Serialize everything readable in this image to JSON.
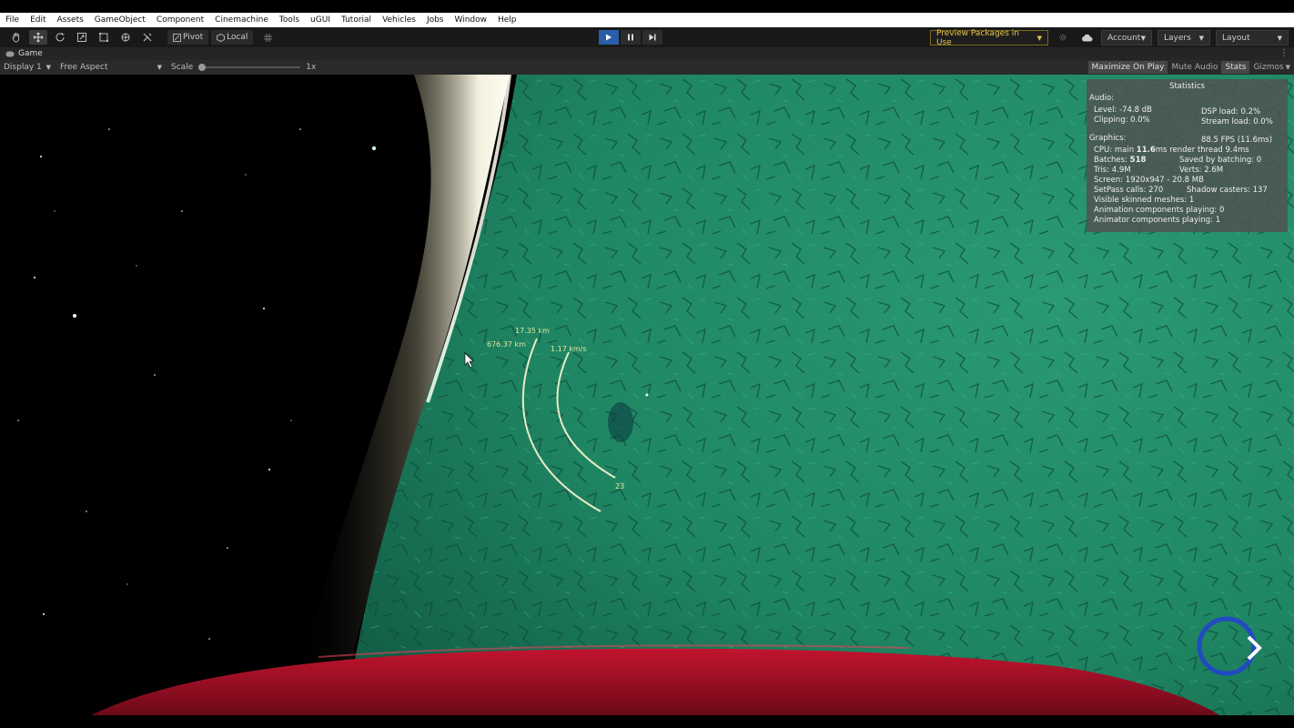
{
  "menubar": {
    "items": [
      "File",
      "Edit",
      "Assets",
      "GameObject",
      "Component",
      "Cinemachine",
      "Tools",
      "uGUI",
      "Tutorial",
      "Vehicles",
      "Jobs",
      "Window",
      "Help"
    ]
  },
  "toolbar": {
    "tools": [
      "hand-tool",
      "move-tool",
      "rotate-tool",
      "scale-tool",
      "rect-tool",
      "transform-tool",
      "custom-tool"
    ],
    "pivot_label": "Pivot",
    "local_label": "Local",
    "preview_packages": "Preview Packages in Use",
    "account": "Account",
    "layers": "Layers",
    "layout": "Layout"
  },
  "tab": {
    "label": "Game"
  },
  "gamebar": {
    "display": "Display 1",
    "aspect": "Free Aspect",
    "scale_label": "Scale",
    "scale_value": "1x",
    "maximize": "Maximize On Play",
    "mute": "Mute Audio",
    "stats": "Stats",
    "gizmos": "Gizmos"
  },
  "stats": {
    "title": "Statistics",
    "audio_header": "Audio:",
    "level": "Level: -74.8 dB",
    "dsp": "DSP load: 0.2%",
    "clipping": "Clipping: 0.0%",
    "stream": "Stream load: 0.0%",
    "graphics_header": "Graphics:",
    "fps": "88.5 FPS (11.6ms)",
    "cpu_prefix": "CPU: main ",
    "cpu_main": "11.6",
    "cpu_suffix": "ms  render thread 9.4ms",
    "batches_prefix": "Batches: ",
    "batches": "518",
    "saved": "Saved by batching: 0",
    "tris": "Tris: 4.9M",
    "verts": "Verts: 2.6M",
    "screen": "Screen: 1920x947 - 20.8 MB",
    "setpass": "SetPass calls: 270",
    "shadow": "Shadow casters: 137",
    "skinned": "Visible skinned meshes: 1",
    "animation": "Animation components playing: 0",
    "animator": "Animator components playing: 1"
  },
  "hud": {
    "altitude": "17.35 km",
    "distance": "676.37 km",
    "speed": "1.17 km/s",
    "number": "23"
  },
  "colors": {
    "planet": "#1f8a63",
    "atmosphere": "#f4f1e0",
    "ship": "#b0102a",
    "hud": "#e0e6a0",
    "play_active": "#2a5ea8",
    "cursor_circle": "#2244cc"
  }
}
